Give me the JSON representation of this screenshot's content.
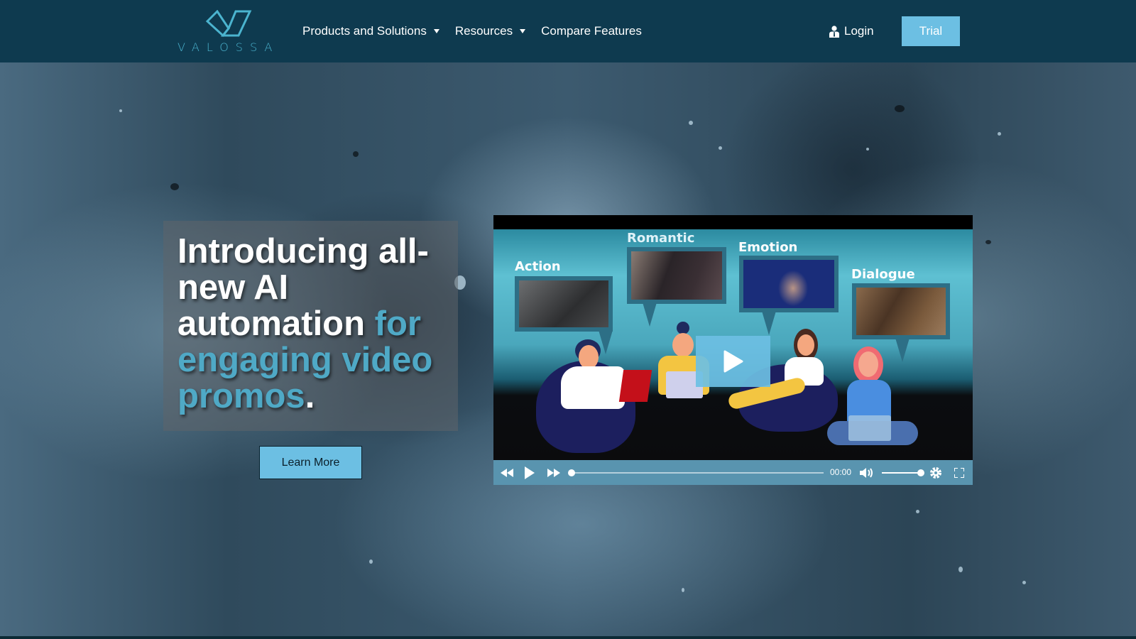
{
  "header": {
    "logo_text": "VALOSSA",
    "nav": [
      {
        "label": "Products and Solutions",
        "has_dropdown": true
      },
      {
        "label": "Resources",
        "has_dropdown": true
      },
      {
        "label": "Compare Features",
        "has_dropdown": false
      }
    ],
    "login_label": "Login",
    "login_icon": "user-icon",
    "trial_label": "Trial"
  },
  "hero": {
    "headline_white": "Introducing all-new AI automation ",
    "headline_accent": "for engaging video promos",
    "headline_end": ".",
    "cta_label": "Learn More"
  },
  "video": {
    "categories": [
      "Action",
      "Romantic",
      "Emotion",
      "Dialogue"
    ],
    "time": "00:00",
    "progress": 0,
    "volume": 1.0,
    "controls": [
      "rewind-icon",
      "play-icon",
      "fast-forward-icon",
      "volume-icon",
      "settings-icon",
      "fullscreen-icon"
    ]
  },
  "colors": {
    "header_bg": "#0e3a4f",
    "accent": "#4fa9c6",
    "button": "#6cbfe3",
    "player_controls": "#5e9cb8"
  }
}
